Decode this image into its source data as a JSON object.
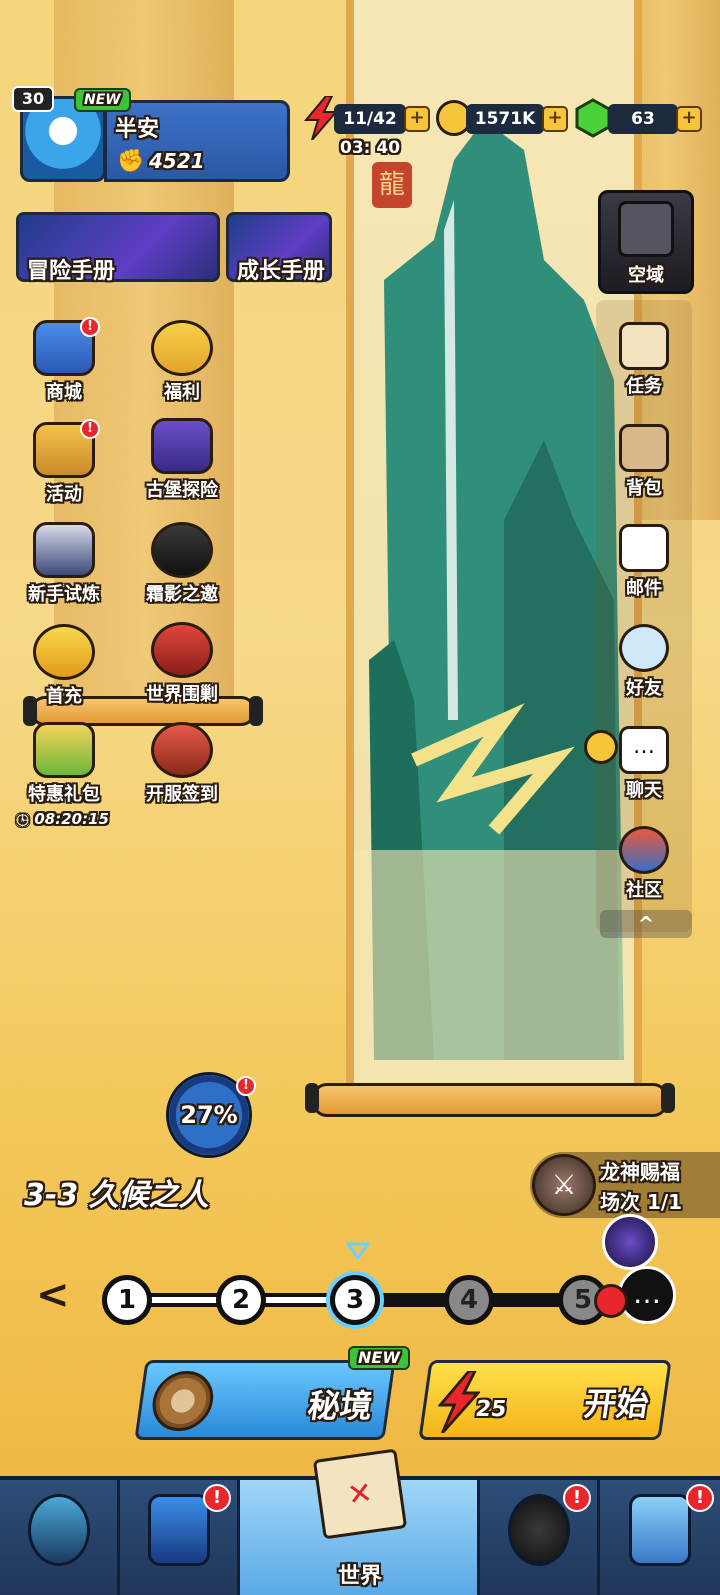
{
  "player": {
    "level": "30",
    "new_badge": "NEW",
    "name": "半安",
    "power": "4521"
  },
  "resources": {
    "energy": "11/42",
    "energy_timer": "03: 40",
    "gold": "1571K",
    "gems": "63",
    "plus": "+"
  },
  "manuals": {
    "adventure": "冒险手册",
    "growth": "成长手册"
  },
  "left_menu": [
    {
      "label": "商城",
      "badge": "!"
    },
    {
      "label": "福利",
      "badge": ""
    },
    {
      "label": "活动",
      "badge": "!"
    },
    {
      "label": "古堡探险",
      "badge": ""
    },
    {
      "label": "新手试炼",
      "badge": ""
    },
    {
      "label": "霜影之邀",
      "badge": ""
    },
    {
      "label": "首充",
      "badge": ""
    },
    {
      "label": "世界围剿",
      "badge": ""
    },
    {
      "label": "特惠礼包",
      "badge": ""
    },
    {
      "label": "开服签到",
      "badge": ""
    }
  ],
  "gift_timer": "08:20:15",
  "right_menu": {
    "void": "空域",
    "items": [
      "任务",
      "背包",
      "邮件",
      "好友",
      "聊天",
      "社区"
    ],
    "collapse": "^"
  },
  "seal_char": "龍",
  "progress": {
    "percent_text": "27%",
    "percent": 27,
    "badge": "!"
  },
  "stage": {
    "title": "3-3 久候之人",
    "dots": [
      "1",
      "2",
      "3",
      "4",
      "5"
    ],
    "current": 3,
    "prev_arrow": "<"
  },
  "blessing": {
    "title": "龙神赐福",
    "count": "场次 1/1"
  },
  "buttons": {
    "secret_realm": "秘境",
    "secret_new": "NEW",
    "start": "开始",
    "start_cost": "25"
  },
  "bottom_nav": {
    "world": "世界",
    "badge": "!"
  },
  "colors": {
    "accent_blue": "#2b58a6",
    "energy_red": "#e8262c",
    "gold": "#f7c53a",
    "gem_green": "#4bd13a"
  }
}
